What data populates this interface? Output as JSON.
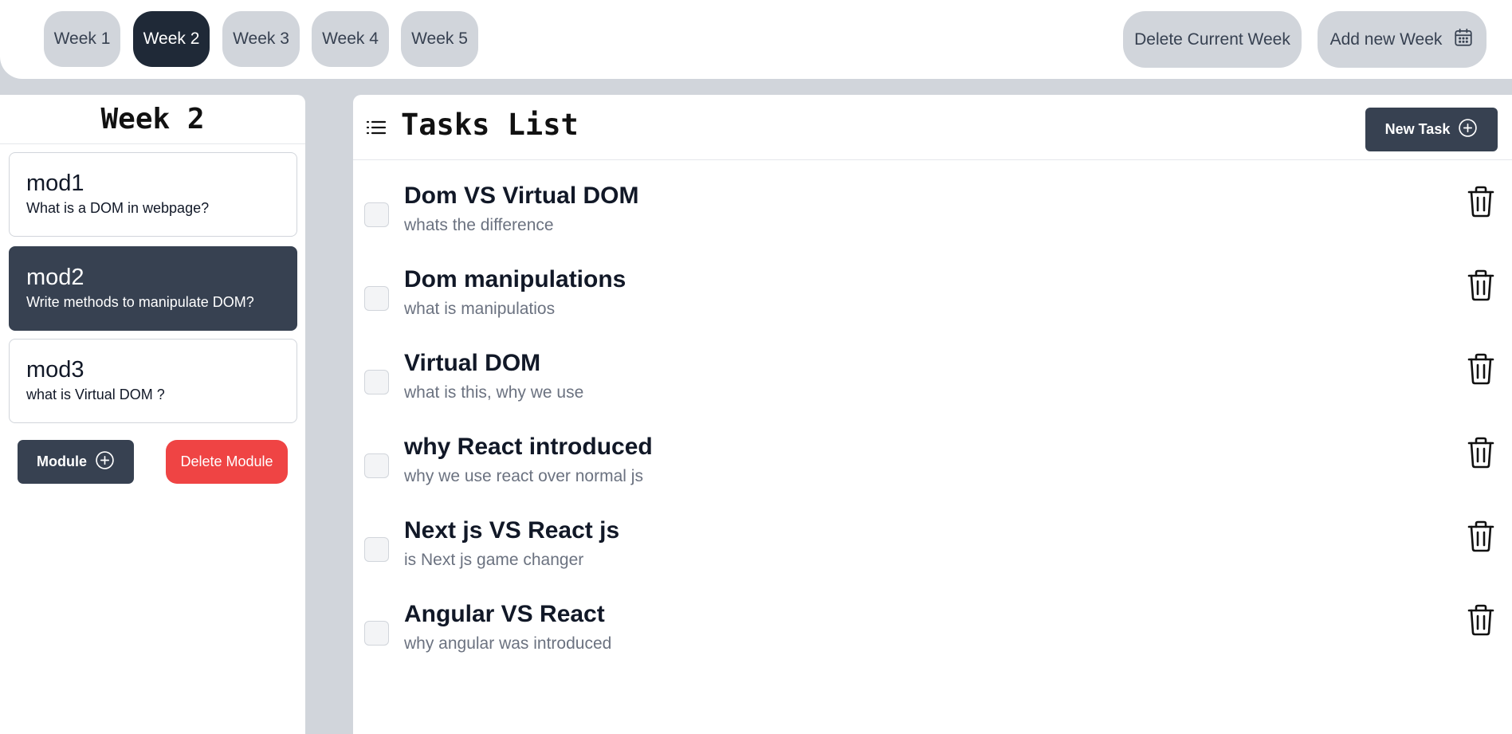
{
  "weeks": {
    "tabs": [
      {
        "label": "Week 1"
      },
      {
        "label": "Week 2"
      },
      {
        "label": "Week 3"
      },
      {
        "label": "Week 4"
      },
      {
        "label": "Week 5"
      }
    ],
    "active_index": 1,
    "delete_label": "Delete Current Week",
    "add_label": "Add new Week",
    "add_icon": "calendar-icon"
  },
  "modules": {
    "title": "Week 2",
    "items": [
      {
        "name": "mod1",
        "desc": "What is a DOM in webpage?"
      },
      {
        "name": "mod2",
        "desc": "Write methods to manipulate DOM?"
      },
      {
        "name": "mod3",
        "desc": "what is Virtual DOM ?"
      }
    ],
    "active_index": 1,
    "add_label": "Module",
    "delete_label": "Delete Module"
  },
  "tasks": {
    "title": "Tasks List",
    "new_label": "New Task",
    "items": [
      {
        "title": "Dom VS Virtual DOM",
        "desc": "whats the difference",
        "done": false
      },
      {
        "title": "Dom manipulations",
        "desc": "what is manipulatios",
        "done": false
      },
      {
        "title": "Virtual DOM",
        "desc": "what is this, why we use",
        "done": false
      },
      {
        "title": "why React introduced",
        "desc": "why we use react over normal js",
        "done": false
      },
      {
        "title": "Next js VS React js",
        "desc": "is Next js game changer",
        "done": false
      },
      {
        "title": "Angular VS React",
        "desc": "why angular was introduced",
        "done": false
      }
    ]
  },
  "colors": {
    "dark": "#1f2937",
    "slate": "#374151",
    "danger": "#ef4444",
    "muted_bg": "#d1d5db"
  }
}
